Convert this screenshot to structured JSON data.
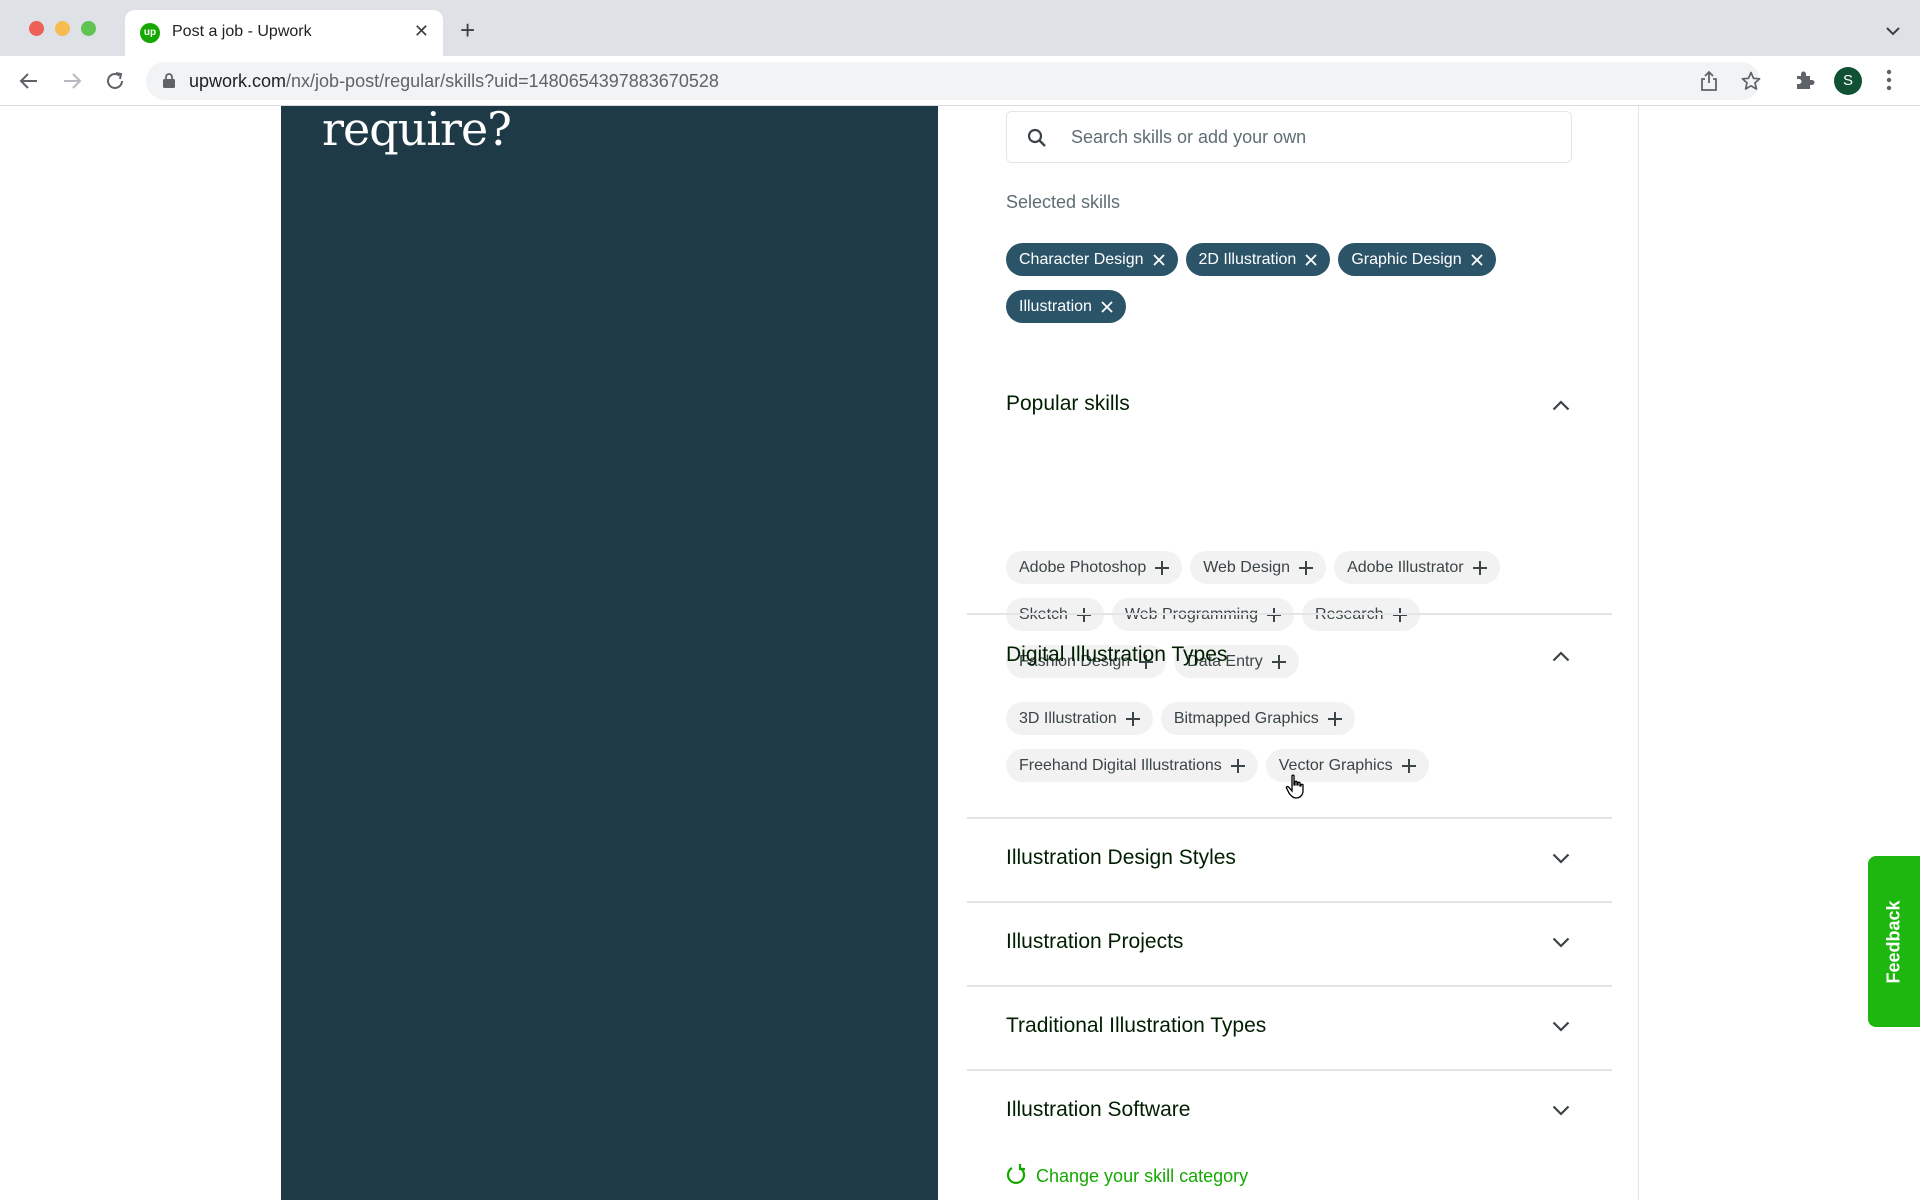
{
  "browser": {
    "tab_title": "Post a job - Upwork",
    "favicon_text": "up",
    "url_domain": "upwork.com",
    "url_path": "/nx/job-post/regular/skills?uid=1480654397883670528",
    "profile_initial": "S"
  },
  "left_panel": {
    "heading_partial": "require?"
  },
  "search": {
    "placeholder": "Search skills or add your own",
    "value": ""
  },
  "selected": {
    "label": "Selected skills",
    "skills": [
      "Character Design",
      "2D Illustration",
      "Graphic Design",
      "Illustration"
    ]
  },
  "sections": [
    {
      "title": "Popular skills",
      "expanded": true,
      "skills": [
        "Adobe Photoshop",
        "Web Design",
        "Adobe Illustrator",
        "Sketch",
        "Web Programming",
        "Research",
        "Fashion Design",
        "Data Entry"
      ]
    },
    {
      "title": "Digital Illustration Types",
      "expanded": true,
      "skills": [
        "3D Illustration",
        "Bitmapped Graphics",
        "Freehand Digital Illustrations",
        "Vector Graphics"
      ]
    },
    {
      "title": "Illustration Design Styles",
      "expanded": false,
      "skills": []
    },
    {
      "title": "Illustration Projects",
      "expanded": false,
      "skills": []
    },
    {
      "title": "Traditional Illustration Types",
      "expanded": false,
      "skills": []
    },
    {
      "title": "Illustration Software",
      "expanded": false,
      "skills": []
    }
  ],
  "change_category_label": "Change your skill category",
  "feedback_label": "Feedback",
  "colors": {
    "brand_green": "#14a800",
    "panel_bg": "#1f3a47",
    "selected_chip": "#2b5468",
    "feedback_green": "#1eb710"
  }
}
